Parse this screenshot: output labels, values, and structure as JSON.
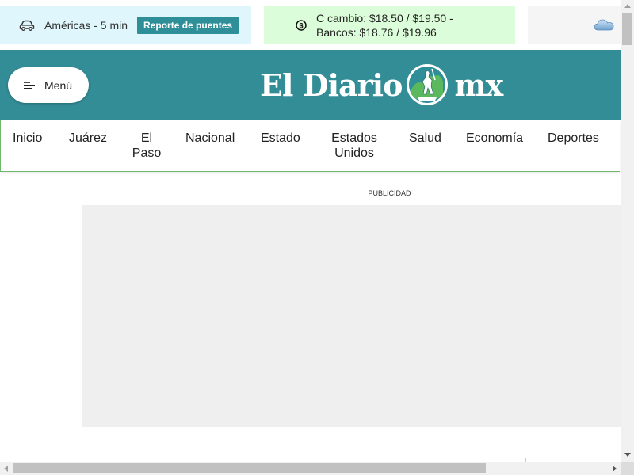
{
  "topbar": {
    "traffic": {
      "icon": "car-icon",
      "text": "Américas - 5 min",
      "button_label": "Reporte de puentes"
    },
    "exchange": {
      "icon": "dollar-icon",
      "line1": "C cambio: $18.50 / $19.50 -",
      "line2": "Bancos: $18.76 / $19.96"
    },
    "weather": {
      "icon": "cloud-icon"
    }
  },
  "masthead": {
    "menu_label": "Menú",
    "logo": {
      "left": "El Diario",
      "right": "mx"
    },
    "colors": {
      "header_bg": "#338d96",
      "accent_green": "#5cb85c"
    }
  },
  "nav": {
    "items": [
      {
        "label": "Inicio"
      },
      {
        "label": "Juárez"
      },
      {
        "label": "El Paso"
      },
      {
        "label": "Nacional"
      },
      {
        "label": "Estado"
      },
      {
        "label": "Estados Unidos"
      },
      {
        "label": "Salud"
      },
      {
        "label": "Economía"
      },
      {
        "label": "Deportes"
      }
    ]
  },
  "content": {
    "ad_label": "PUBLICIDAD"
  }
}
